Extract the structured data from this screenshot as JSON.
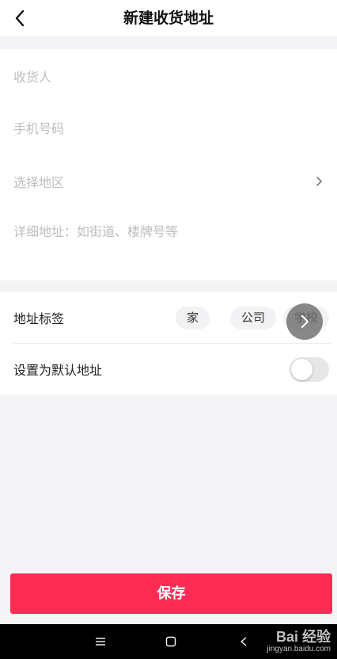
{
  "header": {
    "title": "新建收货地址",
    "back_icon": "chevron-left-icon"
  },
  "form": {
    "recipient_placeholder": "收货人",
    "phone_placeholder": "手机号码",
    "region_placeholder": "选择地区",
    "address_placeholder": "详细地址：如街道、楼牌号等"
  },
  "options": {
    "tag_label": "地址标签",
    "tags": [
      "家",
      "公司",
      "学校"
    ],
    "default_label": "设置为默认地址",
    "default_enabled": false
  },
  "actions": {
    "save_label": "保存"
  },
  "watermark": {
    "logo": "Bai 经验",
    "url": "jingyan.baidu.com"
  },
  "colors": {
    "accent": "#fe2c55",
    "background": "#f4f4f6",
    "placeholder": "#bdbdc2"
  }
}
